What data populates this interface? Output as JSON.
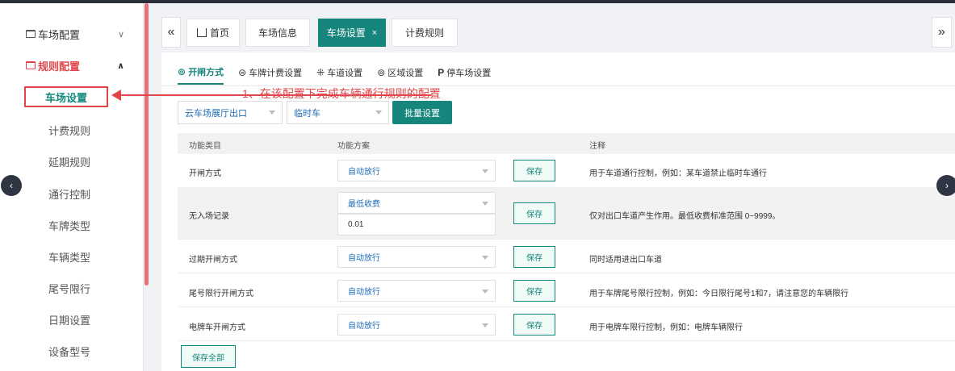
{
  "sidebar": {
    "groups": [
      {
        "label": "车场配置",
        "expanded": false
      },
      {
        "label": "规则配置",
        "expanded": true
      }
    ],
    "items": [
      {
        "label": "车场设置",
        "active": true
      },
      {
        "label": "计费规则"
      },
      {
        "label": "延期规则"
      },
      {
        "label": "通行控制"
      },
      {
        "label": "车牌类型"
      },
      {
        "label": "车辆类型"
      },
      {
        "label": "尾号限行"
      },
      {
        "label": "日期设置"
      },
      {
        "label": "设备型号"
      }
    ]
  },
  "tabs": {
    "prev_icon": "«",
    "next_icon": "»",
    "items": [
      {
        "label": "首页"
      },
      {
        "label": "车场信息"
      },
      {
        "label": "车场设置",
        "active": true,
        "close": "×"
      },
      {
        "label": "计费规则"
      }
    ]
  },
  "subtabs": [
    {
      "label": "开闸方式",
      "icon": "⊚",
      "active": true
    },
    {
      "label": "车牌计费设置",
      "icon": "⊜"
    },
    {
      "label": "车道设置",
      "icon": "⁜"
    },
    {
      "label": "区域设置",
      "icon": "⊚"
    },
    {
      "label": "停车场设置",
      "icon": "P"
    }
  ],
  "filters": {
    "lane": "云车场展厅出口",
    "car_type": "临时车",
    "batch_button": "批量设置"
  },
  "table": {
    "headers": [
      "功能类目",
      "功能方案",
      "",
      "注释"
    ],
    "rows": [
      {
        "category": "开闸方式",
        "option": "自动放行",
        "save": "保存",
        "note": "用于车道通行控制，例如：某车道禁止临时车通行"
      },
      {
        "category": "无入场记录",
        "option": "最低收费",
        "value": "0.01",
        "save": "保存",
        "note": "仅对出口车道产生作用。最低收费标准范围 0~9999。"
      },
      {
        "category": "过期开闸方式",
        "option": "自动放行",
        "save": "保存",
        "note": "同时适用进出口车道"
      },
      {
        "category": "尾号限行开闸方式",
        "option": "自动放行",
        "save": "保存",
        "note": "用于车牌尾号限行控制，例如：今日限行尾号1和7，请注意您的车辆限行"
      },
      {
        "category": "电牌车开闸方式",
        "option": "自动放行",
        "save": "保存",
        "note": "用于电牌车限行控制，例如：电牌车辆限行"
      }
    ]
  },
  "save_all": "保存全部",
  "annotation": "1、在该配置下完成车辆通行规则的配置",
  "nav": {
    "left": "‹",
    "right": "›"
  },
  "colors": {
    "accent": "#16857c",
    "highlight": "#e0464a",
    "link": "#1e6bb8"
  }
}
